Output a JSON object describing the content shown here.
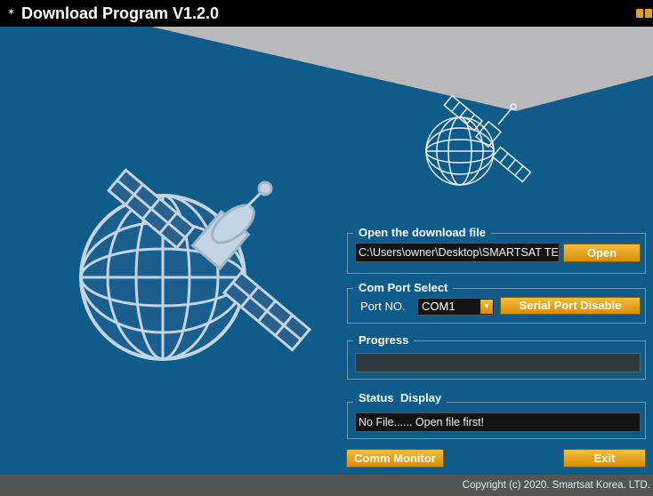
{
  "window": {
    "title": "Download Program V1.2.0",
    "app_icon": "program-icon",
    "accent_color": "#e4a314",
    "background_color": "#0f5b8a"
  },
  "download": {
    "group_title": "Open the download file",
    "file_path": "C:\\Users\\owner\\Desktop\\SMARTSAT TE",
    "open_label": "Open"
  },
  "com_port": {
    "group_title": "Com Port Select",
    "port_label": "Port NO.",
    "selected_port": "COM1",
    "serial_button_label": "Serial Port Disable"
  },
  "progress": {
    "group_title": "Progress",
    "value": 0
  },
  "status": {
    "group_title": "Status  Display",
    "message": "No File...... Open file first!"
  },
  "bottom": {
    "comm_monitor_label": "Comm Monitor",
    "exit_label": "Exit"
  },
  "footer": {
    "copyright": "Copyright (c) 2020. Smartsat Korea. LTD."
  }
}
